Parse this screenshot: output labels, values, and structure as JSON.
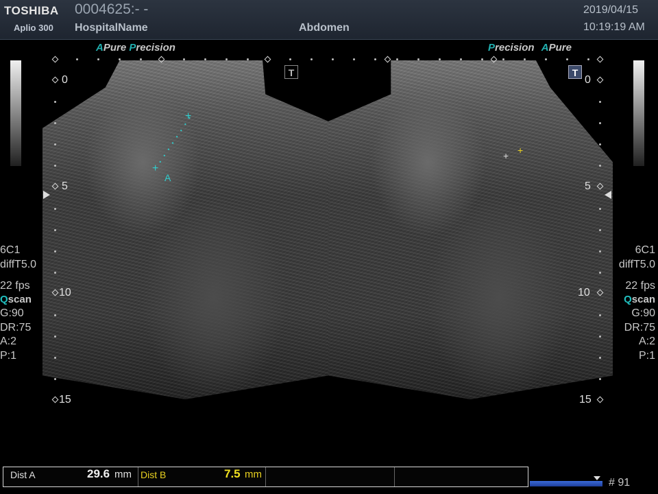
{
  "header": {
    "brand": "TOSHIBA",
    "model": "Aplio 300",
    "patient_id": "0004625:- -",
    "hospital": "HospitalName",
    "exam": "Abdomen",
    "date": "2019/04/15",
    "time": "10:19:19 AM"
  },
  "panels": {
    "left": {
      "badge_a": "A",
      "badge_pure": "Pure",
      "badge_p": "P",
      "badge_precision": "recision",
      "t_button": "T"
    },
    "right": {
      "badge_p": "P",
      "badge_precision": "recision",
      "badge_a": "A",
      "badge_pure": "Pure",
      "t_button": "T"
    }
  },
  "depth_labels": [
    "0",
    "5",
    "10",
    "15"
  ],
  "caliper_label": "A",
  "scan_params": {
    "probe": "6C1",
    "filter": "diffT5.0",
    "fps": "22 fps",
    "mode_q": "Q",
    "mode_rest": "scan",
    "gain": "G:90",
    "dr": "DR:75",
    "a": "A:2",
    "p": "P:1"
  },
  "measurements": {
    "dist_a_label": "Dist A",
    "dist_a_value": "29.6",
    "dist_a_unit": "mm",
    "dist_b_label": "Dist B",
    "dist_b_value": "7.5",
    "dist_b_unit": "mm"
  },
  "frame_counter": "# 91",
  "colors": {
    "accent_cyan": "#21b0b0",
    "dist_b_yellow": "#f0e020",
    "progress_blue": "#2a55c0"
  }
}
